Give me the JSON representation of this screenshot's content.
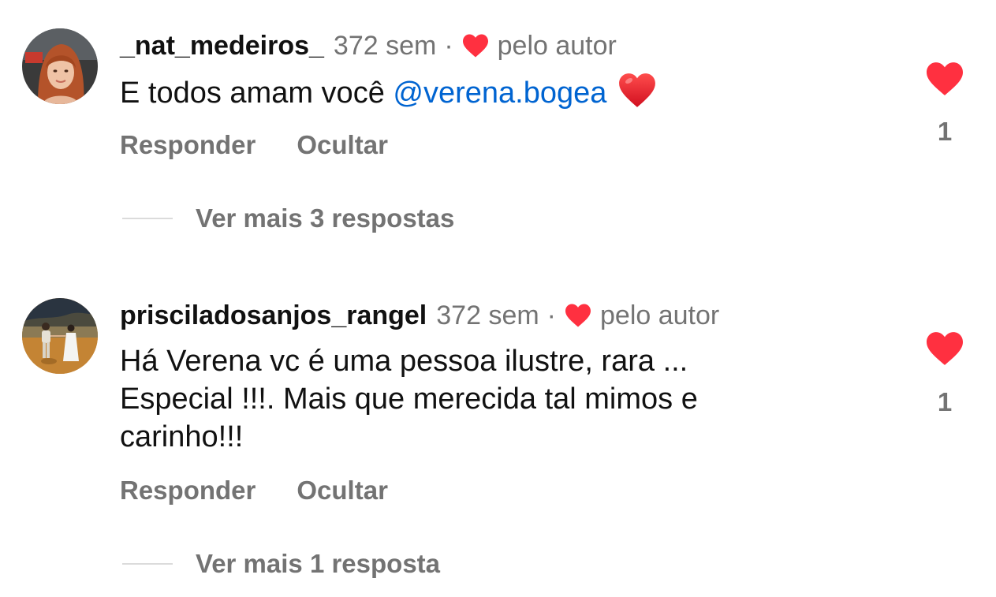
{
  "comments": [
    {
      "username": "_nat_medeiros_",
      "time": "372 sem",
      "separator": "·",
      "liked_by_author_label": "pelo autor",
      "text": "E todos amam você ",
      "mention": "@verena.bogea",
      "emoji": "heart-emoji",
      "reply_label": "Responder",
      "hide_label": "Ocultar",
      "more_replies_label": "Ver mais 3 respostas",
      "likes": "1"
    },
    {
      "username": "prisciladosanjos_rangel",
      "time": "372 sem",
      "separator": "·",
      "liked_by_author_label": "pelo autor",
      "text": "Há Verena vc é uma pessoa ilustre, rara ... Especial !!!. Mais que merecida tal mimos e carinho!!!",
      "reply_label": "Responder",
      "hide_label": "Ocultar",
      "more_replies_label": "Ver mais 1 resposta",
      "likes": "1"
    }
  ],
  "colors": {
    "heart_red": "#ff3040",
    "secondary_text": "#737373",
    "mention_blue": "#0064d1",
    "divider": "#dbdbdb"
  }
}
